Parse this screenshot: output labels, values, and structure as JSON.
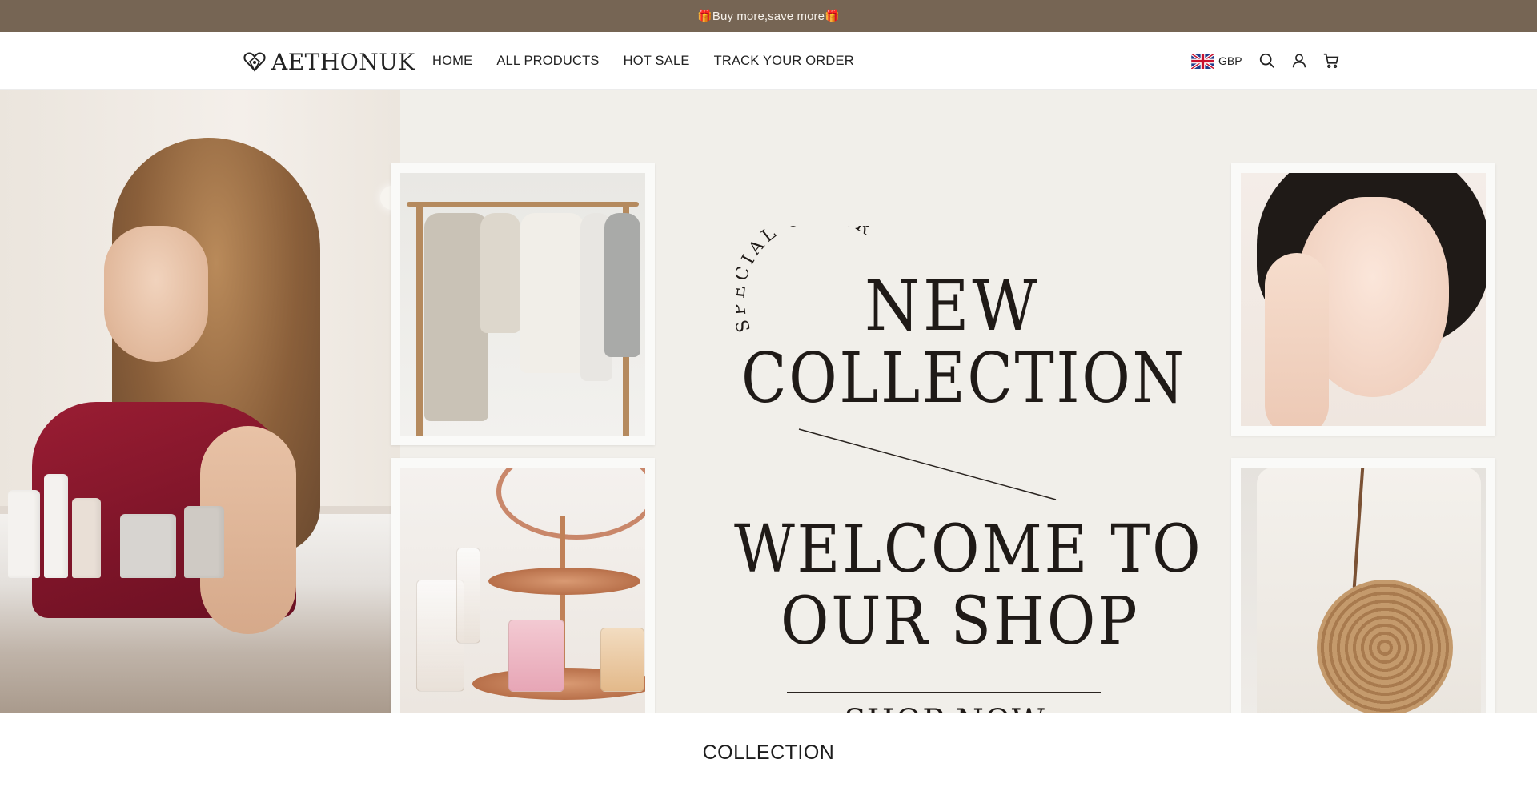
{
  "announcement": {
    "text": "🎁Buy more,save more🎁"
  },
  "header": {
    "logo_text": "AETHONUK",
    "nav": [
      {
        "label": "HOME"
      },
      {
        "label": "ALL PRODUCTS"
      },
      {
        "label": "HOT SALE"
      },
      {
        "label": "TRACK YOUR ORDER"
      }
    ],
    "currency": {
      "code": "GBP",
      "flag_icon": "uk-flag-icon"
    },
    "icons": [
      "search-icon",
      "account-icon",
      "cart-icon"
    ]
  },
  "hero": {
    "special_offer": "SPECIAL OFFER",
    "title_line1": "NEW",
    "title_line2": "COLLECTION",
    "welcome_line1": "WELCOME TO",
    "welcome_line2": "OUR SHOP",
    "cta_label": "SHOP NOW",
    "background_color": "#f1efea"
  },
  "section": {
    "heading": "COLLECTION"
  },
  "colors": {
    "announcement_bg": "#766554",
    "announcement_text": "#f6f1ea",
    "text_dark": "#1f1a17"
  }
}
